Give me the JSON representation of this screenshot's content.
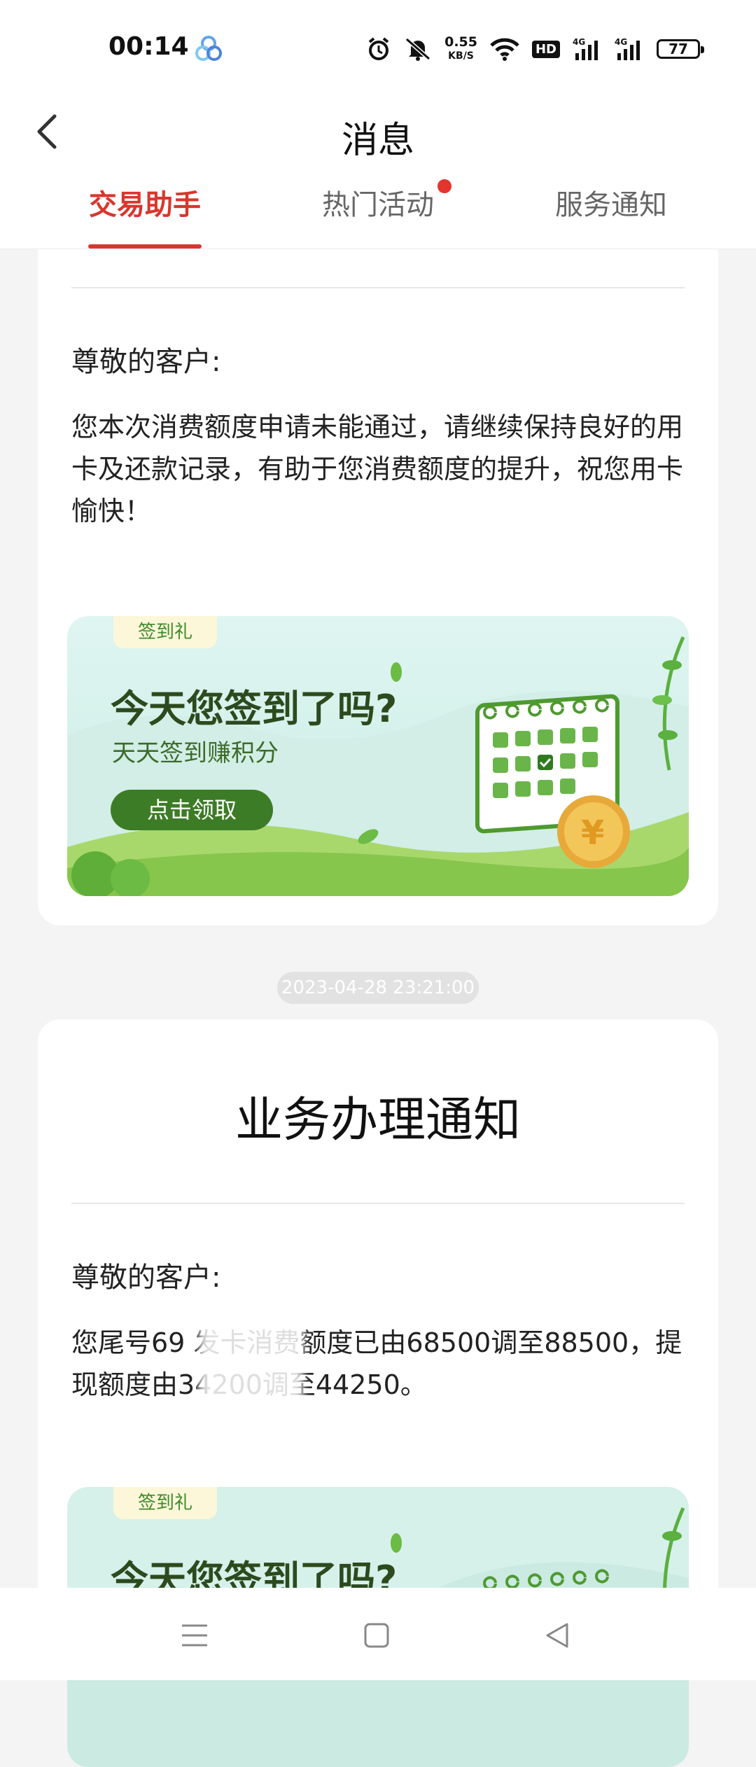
{
  "status_bar": {
    "time": "00:14",
    "speed_value": "0.55",
    "speed_unit": "KB/S",
    "hd_label": "HD",
    "network_1": "4G",
    "network_2": "4G",
    "battery": "77",
    "icons": [
      "app-badge-icon",
      "alarm-icon",
      "mute-bell-icon",
      "wifi-icon",
      "signal-icon",
      "signal-icon",
      "battery-icon"
    ]
  },
  "header": {
    "title": "消息",
    "back_icon": "chevron-left-icon",
    "tabs": [
      {
        "label": "交易助手",
        "active": true
      },
      {
        "label": "热门活动",
        "active": false,
        "has_dot": true
      },
      {
        "label": "服务通知",
        "active": false
      }
    ]
  },
  "messages": [
    {
      "salutation": "尊敬的客户:",
      "body": "您本次消费额度申请未能通过，请继续保持良好的用卡及还款记录，有助于您消费额度的提升，祝您用卡愉快！",
      "banner": {
        "tag": "签到礼",
        "headline": "今天您签到了吗?",
        "subtitle": "天天签到赚积分",
        "button": "点击领取"
      }
    },
    {
      "timestamp": "2023-04-28 23:21:00",
      "title": "业务办理通知",
      "salutation": "尊敬的客户:",
      "body": "您尾号69 发卡消费额度已由68500调至88500，提现额度由34200调至44250。",
      "banner": {
        "tag": "签到礼",
        "headline": "今天您签到了吗?"
      }
    }
  ],
  "colors": {
    "accent": "#d9362d",
    "background": "#f4f4f4",
    "banner_green": "#3d7c26"
  },
  "nav_bar": {
    "icons": [
      "menu-icon",
      "home-square-icon",
      "back-triangle-icon"
    ]
  }
}
